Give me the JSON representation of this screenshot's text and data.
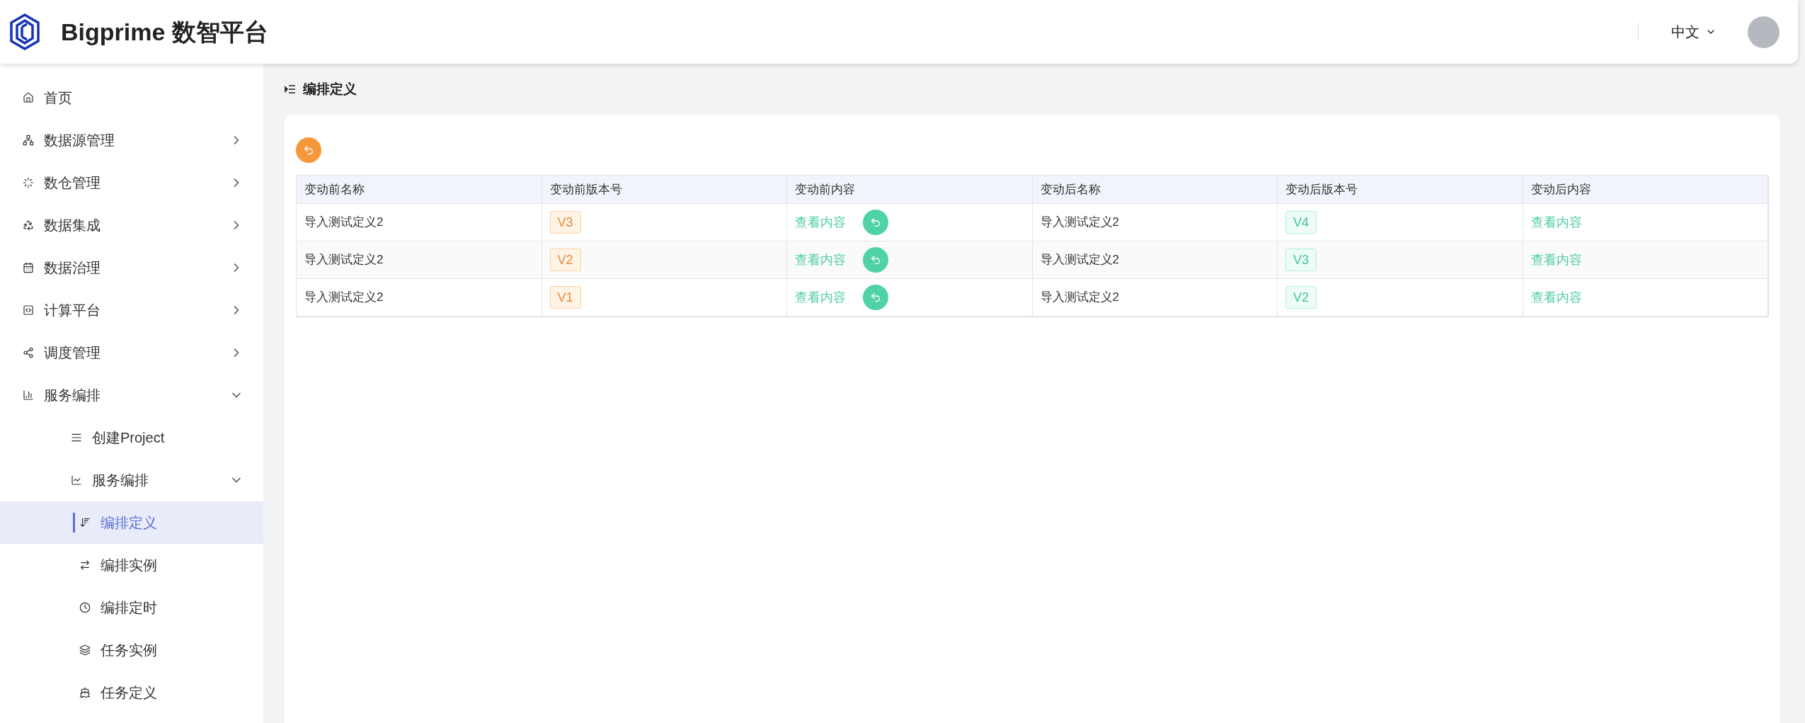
{
  "header": {
    "title": "Bigprime 数智平台",
    "language": "中文"
  },
  "sidebar": {
    "items": [
      {
        "label": "首页",
        "selected": false
      },
      {
        "label": "数据源管理",
        "selected": false,
        "expanded": false
      },
      {
        "label": "数仓管理",
        "selected": false,
        "expanded": false
      },
      {
        "label": "数据集成",
        "selected": false,
        "expanded": false
      },
      {
        "label": "数据治理",
        "selected": false,
        "expanded": false
      },
      {
        "label": "计算平台",
        "selected": false,
        "expanded": false
      },
      {
        "label": "调度管理",
        "selected": false,
        "expanded": false
      },
      {
        "label": "服务编排",
        "selected": false,
        "expanded": true,
        "children": [
          {
            "label": "创建Project",
            "selected": false
          },
          {
            "label": "服务编排",
            "selected": false,
            "expanded": true,
            "children": [
              {
                "label": "编排定义",
                "selected": true
              },
              {
                "label": "编排实例",
                "selected": false
              },
              {
                "label": "编排定时",
                "selected": false
              },
              {
                "label": "任务实例",
                "selected": false
              },
              {
                "label": "任务定义",
                "selected": false
              }
            ]
          }
        ]
      }
    ]
  },
  "page": {
    "title": "编排定义"
  },
  "table": {
    "columns": [
      "变动前名称",
      "变动前版本号",
      "变动前内容",
      "变动后名称",
      "变动后版本号",
      "变动后内容"
    ],
    "rows": [
      {
        "before_name": "导入测试定义2",
        "before_version": "V3",
        "before_content": "查看内容",
        "after_name": "导入测试定义2",
        "after_version": "V4",
        "after_content": "查看内容"
      },
      {
        "before_name": "导入测试定义2",
        "before_version": "V2",
        "before_content": "查看内容",
        "after_name": "导入测试定义2",
        "after_version": "V3",
        "after_content": "查看内容"
      },
      {
        "before_name": "导入测试定义2",
        "before_version": "V1",
        "before_content": "查看内容",
        "after_name": "导入测试定义2",
        "after_version": "V2",
        "after_content": "查看内容"
      }
    ]
  }
}
